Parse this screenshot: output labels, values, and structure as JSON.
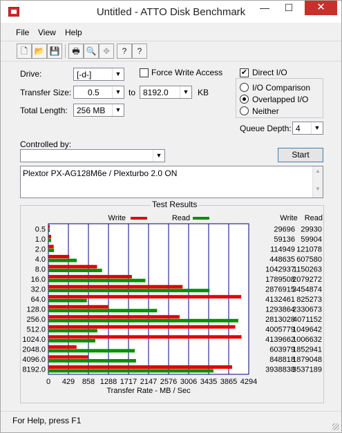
{
  "window": {
    "title": "Untitled - ATTO Disk Benchmark",
    "minimize_glyph": "—",
    "maximize_glyph": "☐",
    "close_glyph": "✕"
  },
  "menu": {
    "file": "File",
    "view": "View",
    "help": "Help"
  },
  "toolbar": {
    "icons": [
      "new-icon",
      "open-icon",
      "save-icon",
      "print-icon",
      "print-preview-icon",
      "move-icon",
      "about-icon",
      "context-help-icon"
    ],
    "glyphs": [
      "🗋",
      "📂",
      "💾",
      "🖶",
      "🔍",
      "✥",
      "?",
      "?"
    ]
  },
  "settings": {
    "drive_label": "Drive:",
    "drive_value": "[-d-]",
    "force_write_access_label": "Force Write Access",
    "force_write_access_checked": false,
    "direct_io_label": "Direct I/O",
    "direct_io_checked": true,
    "transfer_size_label": "Transfer Size:",
    "transfer_from": "0.5",
    "to_label": "to",
    "transfer_to": "8192.0",
    "kb_label": "KB",
    "total_length_label": "Total Length:",
    "total_length_value": "256 MB",
    "io_comparison_label": "I/O Comparison",
    "overlapped_io_label": "Overlapped I/O",
    "neither_label": "Neither",
    "io_mode_selected": "Overlapped I/O",
    "queue_depth_label": "Queue Depth:",
    "queue_depth_value": "4",
    "controlled_by_label": "Controlled by:",
    "controlled_by_value": "",
    "start_button": "Start",
    "description": "Plextor PX-AG128M6e / Plexturbo 2.0 ON"
  },
  "results": {
    "title": "Test Results",
    "write_legend": "Write",
    "read_legend": "Read",
    "write_col_header": "Write",
    "read_col_header": "Read",
    "colors": {
      "write": "#e00000",
      "read": "#009000",
      "grid": "#000080"
    }
  },
  "chart_data": {
    "type": "bar",
    "orientation": "horizontal",
    "title": "Test Results",
    "xlabel": "Transfer Rate - MB / Sec",
    "xlim": [
      0,
      4294
    ],
    "x_ticks": [
      "0",
      "429",
      "858",
      "1288",
      "1717",
      "2147",
      "2576",
      "3006",
      "3435",
      "3865",
      "4294"
    ],
    "categories": [
      "0.5",
      "1.0",
      "2.0",
      "4.0",
      "8.0",
      "16.0",
      "32.0",
      "64.0",
      "128.0",
      "256.0",
      "512.0",
      "1024.0",
      "2048.0",
      "4096.0",
      "8192.0"
    ],
    "series": [
      {
        "name": "Write",
        "color": "#e00000",
        "values": [
          29696,
          59136,
          114949,
          448635,
          1042937,
          1789508,
          2876915,
          4132461,
          1293864,
          2813028,
          4005779,
          4139662,
          603979,
          848818,
          3938838
        ]
      },
      {
        "name": "Read",
        "color": "#009000",
        "values": [
          29930,
          59904,
          121078,
          607580,
          1150263,
          2079272,
          3454874,
          825273,
          2330673,
          4071152,
          1049642,
          1006632,
          1852941,
          1879048,
          3537189
        ]
      }
    ],
    "grid": true
  },
  "status": {
    "text": "For Help, press F1"
  }
}
